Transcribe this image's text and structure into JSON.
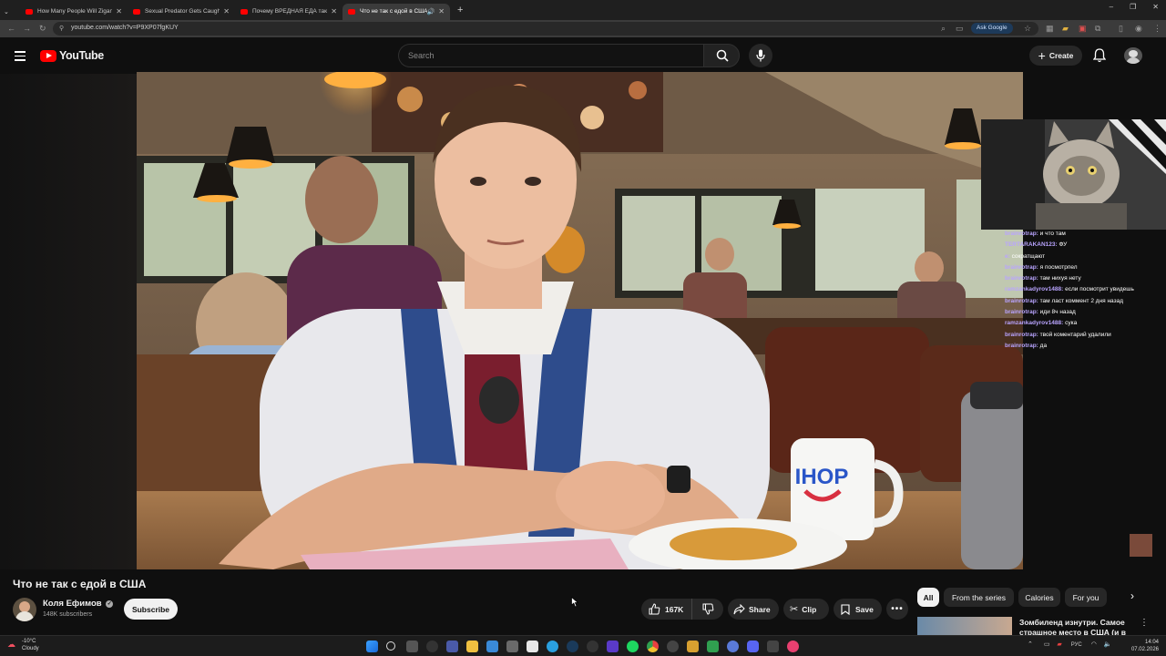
{
  "browser": {
    "tabs": [
      {
        "title": "How Many People Will Zigan! 5"
      },
      {
        "title": "Sexual Predator Gets Caught in"
      },
      {
        "title": "Почему ВРЕДНАЯ ЕДА такая В"
      },
      {
        "title": "Что не так с едой в США"
      }
    ],
    "active_tab": 3,
    "url": "youtube.com/watch?v=P9XP07fgKUY",
    "ask_google_label": "Ask Google"
  },
  "header": {
    "logo_text": "YouTube",
    "search_placeholder": "Search",
    "create_label": "Create"
  },
  "overlay": {
    "chat": [
      {
        "user": "brainrotrap:",
        "msg": "и что там"
      },
      {
        "user": "TERTARAKAN123:",
        "msg": "ФУ"
      },
      {
        "user": "e:",
        "msg": "сократщают"
      },
      {
        "user": "brainrotrap:",
        "msg": "я посмотрпел"
      },
      {
        "user": "brainrotrap:",
        "msg": "там нихуя нету"
      },
      {
        "user": "ramzankadyrov1488:",
        "msg": "если посмотрит увидешь"
      },
      {
        "user": "brainrotrap:",
        "msg": "там ласт коммент 2 дня назад"
      },
      {
        "user": "brainrotrap:",
        "msg": "иди 8ч назад"
      },
      {
        "user": "ramzankadyrov1488:",
        "msg": "сука"
      },
      {
        "user": "brainrotrap:",
        "msg": "твой коментарий удалили"
      },
      {
        "user": "brainrotrap:",
        "msg": "да"
      }
    ]
  },
  "video": {
    "title": "Что не так с едой в США",
    "mug_text": "IHOP"
  },
  "channel": {
    "name": "Коля Ефимов",
    "subscribers": "148K subscribers",
    "subscribe_label": "Subscribe"
  },
  "actions": {
    "likes": "167K",
    "share_label": "Share",
    "clip_label": "Clip",
    "save_label": "Save"
  },
  "chips": [
    "All",
    "From the series",
    "Calories",
    "For you"
  ],
  "suggestion": {
    "title": "Зомбиленд изнутри. Самое страшное место в США (и в"
  },
  "taskbar": {
    "weather_temp": "-10°C",
    "weather_desc": "Cloudy",
    "lang": "РУС",
    "time": "14:04",
    "date": "07.02.2026"
  }
}
